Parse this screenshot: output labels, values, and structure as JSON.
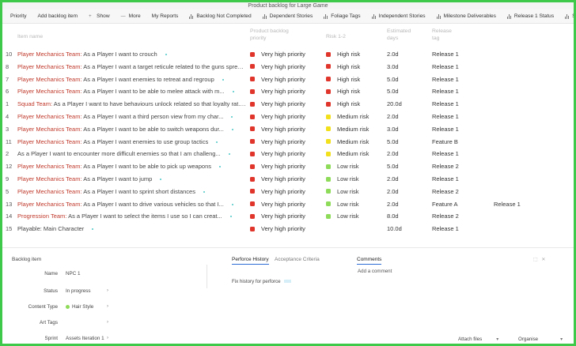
{
  "window": {
    "title": "Product backlog for Large Game"
  },
  "toolbar": {
    "items": [
      {
        "label": "Priority",
        "icon": ""
      },
      {
        "label": "Add backlog item",
        "icon": ""
      },
      {
        "label": "Show",
        "icon": "plus-icon"
      },
      {
        "label": "More",
        "icon": "dash-icon"
      },
      {
        "label": "My Reports",
        "icon": ""
      },
      {
        "label": "Backlog Not Completed",
        "icon": "bar-chart-icon"
      },
      {
        "label": "Dependent Stories",
        "icon": "bar-chart-icon"
      },
      {
        "label": "Foliage Tags",
        "icon": "bar-chart-icon"
      },
      {
        "label": "Independent Stories",
        "icon": "bar-chart-icon"
      },
      {
        "label": "Milestone Deliverables",
        "icon": "bar-chart-icon"
      },
      {
        "label": "Release 1 Status",
        "icon": "bar-chart-icon"
      },
      {
        "label": "Status",
        "icon": "bar-chart-icon"
      }
    ]
  },
  "columns": {
    "name": "Item name",
    "priority": "Product backlog priority",
    "risk": "Risk 1-2",
    "estimate": "Estimated days",
    "release": "Release tag"
  },
  "colors": {
    "very_high": "#e0352b",
    "high_risk": "#e0352b",
    "medium_risk": "#f2e01c",
    "low_risk": "#8edb5a",
    "accent": "#3ec94a"
  },
  "rows": [
    {
      "num": "10",
      "team": "Player Mechanics Team:",
      "story": " As a Player I want to crouch",
      "priority": "Very high priority",
      "risk": "High risk",
      "risk_level": "high",
      "estimate": "2.0d",
      "release": "Release 1",
      "release2": ""
    },
    {
      "num": "8",
      "team": "Player Mechanics Team:",
      "story": " As a Player I want a target reticule related to the guns sprea...",
      "priority": "Very high priority",
      "risk": "High risk",
      "risk_level": "high",
      "estimate": "3.0d",
      "release": "Release 1",
      "release2": ""
    },
    {
      "num": "7",
      "team": "Player Mechanics Team:",
      "story": " As a Player I want enemies to retreat and regroup",
      "priority": "Very high priority",
      "risk": "High risk",
      "risk_level": "high",
      "estimate": "5.0d",
      "release": "Release 1",
      "release2": ""
    },
    {
      "num": "6",
      "team": "Player Mechanics Team:",
      "story": " As a Player I want to be able to melee attack with m...",
      "priority": "Very high priority",
      "risk": "High risk",
      "risk_level": "high",
      "estimate": "5.0d",
      "release": "Release 1",
      "release2": ""
    },
    {
      "num": "1",
      "team": "Squad Team:",
      "story": " As a Player I want to have behaviours unlock related so that loyalty rat...",
      "priority": "Very high priority",
      "risk": "High risk",
      "risk_level": "high",
      "estimate": "20.0d",
      "release": "Release 1",
      "release2": ""
    },
    {
      "num": "4",
      "team": "Player Mechanics Team:",
      "story": " As a Player I want a third person view from my char...",
      "priority": "Very high priority",
      "risk": "Medium risk",
      "risk_level": "medium",
      "estimate": "2.0d",
      "release": "Release 1",
      "release2": ""
    },
    {
      "num": "3",
      "team": "Player Mechanics Team:",
      "story": " As a Player I want to be able to switch weapons dur...",
      "priority": "Very high priority",
      "risk": "Medium risk",
      "risk_level": "medium",
      "estimate": "3.0d",
      "release": "Release 1",
      "release2": ""
    },
    {
      "num": "11",
      "team": "Player Mechanics Team:",
      "story": " As a Player I want enemies to use group tactics",
      "priority": "Very high priority",
      "risk": "Medium risk",
      "risk_level": "medium",
      "estimate": "5.0d",
      "release": "Feature B",
      "release2": ""
    },
    {
      "num": "2",
      "team": "",
      "story": "As a Player I want to encounter more difficult enemies so that I am challeng...",
      "priority": "Very high priority",
      "risk": "Medium risk",
      "risk_level": "medium",
      "estimate": "2.0d",
      "release": "Release 1",
      "release2": ""
    },
    {
      "num": "12",
      "team": "Player Mechanics Team:",
      "story": " As a Player I want to be able to pick up weapons",
      "priority": "Very high priority",
      "risk": "Low risk",
      "risk_level": "low",
      "estimate": "5.0d",
      "release": "Release 2",
      "release2": ""
    },
    {
      "num": "9",
      "team": "Player Mechanics Team:",
      "story": " As a Player I want to jump",
      "priority": "Very high priority",
      "risk": "Low risk",
      "risk_level": "low",
      "estimate": "2.0d",
      "release": "Release 1",
      "release2": ""
    },
    {
      "num": "5",
      "team": "Player Mechanics Team:",
      "story": " As a Player I want to sprint short distances",
      "priority": "Very high priority",
      "risk": "Low risk",
      "risk_level": "low",
      "estimate": "2.0d",
      "release": "Release 2",
      "release2": ""
    },
    {
      "num": "13",
      "team": "Player Mechanics Team:",
      "story": " As a Player I want to drive various vehicles so that I...",
      "priority": "Very high priority",
      "risk": "Low risk",
      "risk_level": "low",
      "estimate": "2.0d",
      "release": "Feature A",
      "release2": "Release 1"
    },
    {
      "num": "14",
      "team": "Progression Team:",
      "story": " As a Player I want to select the items I use so I can creat...",
      "priority": "Very high priority",
      "risk": "Low risk",
      "risk_level": "low",
      "estimate": "8.0d",
      "release": "Release 2",
      "release2": ""
    },
    {
      "num": "15",
      "team": "",
      "story": "Playable: Main Character",
      "priority": "Very high priority",
      "risk": "",
      "risk_level": "",
      "estimate": "10.0d",
      "release": "Release 1",
      "release2": ""
    }
  ],
  "backlog_item": {
    "title": "Backlog item",
    "fields": [
      {
        "label": "Name",
        "value": "NPC 1"
      },
      {
        "label": "Status",
        "value": "In progress"
      },
      {
        "label": "Content Type",
        "value": "Hair Style"
      },
      {
        "label": "Art Tags",
        "value": ""
      },
      {
        "label": "Sprint",
        "value": "Assets Iteration 1"
      }
    ]
  },
  "detail_tabs": {
    "history": "Perforce History",
    "criteria": "Acceptance Criteria",
    "comments": "Comments"
  },
  "history_text": "Fix history for perforce",
  "add_comment": "Add a comment",
  "footer": {
    "attach": "Attach files",
    "organise": "Organise"
  }
}
